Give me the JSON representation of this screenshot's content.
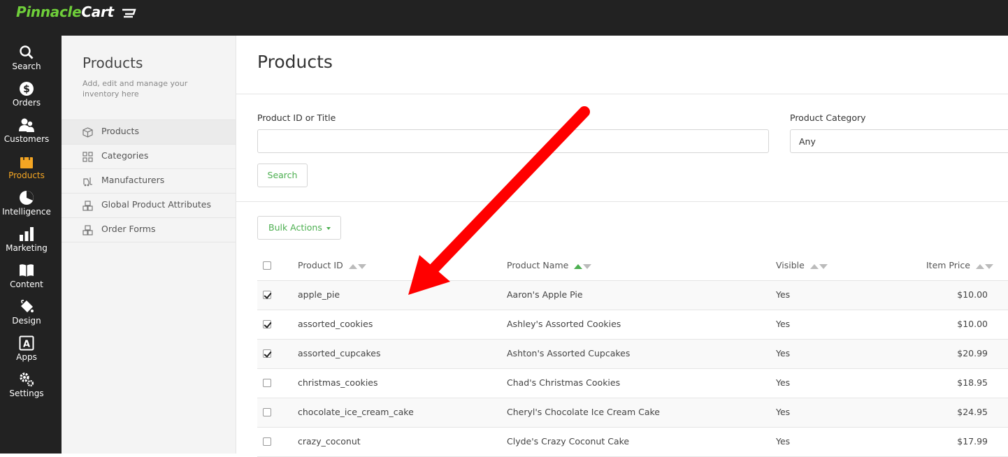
{
  "brand": {
    "logo_part1": "Pinnacle",
    "logo_part2": "Cart"
  },
  "nav": {
    "items": [
      {
        "label": "Search",
        "icon": "search-icon"
      },
      {
        "label": "Orders",
        "icon": "dollar-icon"
      },
      {
        "label": "Customers",
        "icon": "users-icon"
      },
      {
        "label": "Products",
        "icon": "shopping-bag-icon",
        "active": true
      },
      {
        "label": "Intelligence",
        "icon": "pie-chart-icon"
      },
      {
        "label": "Marketing",
        "icon": "bar-chart-icon"
      },
      {
        "label": "Content",
        "icon": "book-icon"
      },
      {
        "label": "Design",
        "icon": "paint-bucket-icon"
      },
      {
        "label": "Apps",
        "icon": "app-icon"
      },
      {
        "label": "Settings",
        "icon": "gears-icon"
      }
    ]
  },
  "subnav": {
    "title": "Products",
    "description": "Add, edit and manage your inventory here",
    "items": [
      {
        "label": "Products",
        "icon": "box-icon",
        "selected": true
      },
      {
        "label": "Categories",
        "icon": "grid-icon"
      },
      {
        "label": "Manufacturers",
        "icon": "forklift-icon"
      },
      {
        "label": "Global Product Attributes",
        "icon": "boxes-icon"
      },
      {
        "label": "Order Forms",
        "icon": "boxes-icon"
      }
    ]
  },
  "main": {
    "title": "Products",
    "filters": {
      "id_label": "Product ID or Title",
      "id_value": "",
      "category_label": "Product Category",
      "category_value": "Any",
      "search_button": "Search"
    },
    "bulk_actions": "Bulk Actions",
    "table": {
      "headers": {
        "id": "Product ID",
        "name": "Product Name",
        "visible": "Visible",
        "price": "Item Price"
      },
      "rows": [
        {
          "checked": true,
          "id": "apple_pie",
          "name": "Aaron's Apple Pie",
          "visible": "Yes",
          "price": "$10.00"
        },
        {
          "checked": true,
          "id": "assorted_cookies",
          "name": "Ashley's Assorted Cookies",
          "visible": "Yes",
          "price": "$10.00"
        },
        {
          "checked": true,
          "id": "assorted_cupcakes",
          "name": "Ashton's Assorted Cupcakes",
          "visible": "Yes",
          "price": "$20.99"
        },
        {
          "checked": false,
          "id": "christmas_cookies",
          "name": "Chad's Christmas Cookies",
          "visible": "Yes",
          "price": "$18.95"
        },
        {
          "checked": false,
          "id": "chocolate_ice_cream_cake",
          "name": "Cheryl's Chocolate Ice Cream Cake",
          "visible": "Yes",
          "price": "$24.95"
        },
        {
          "checked": false,
          "id": "crazy_coconut",
          "name": "Clyde's Crazy Coconut Cake",
          "visible": "Yes",
          "price": "$17.99"
        }
      ]
    }
  },
  "colors": {
    "accent_green": "#4caf50",
    "active_orange": "#f5a623",
    "annotation_red": "#ff0000",
    "dark_bg": "#222222"
  }
}
